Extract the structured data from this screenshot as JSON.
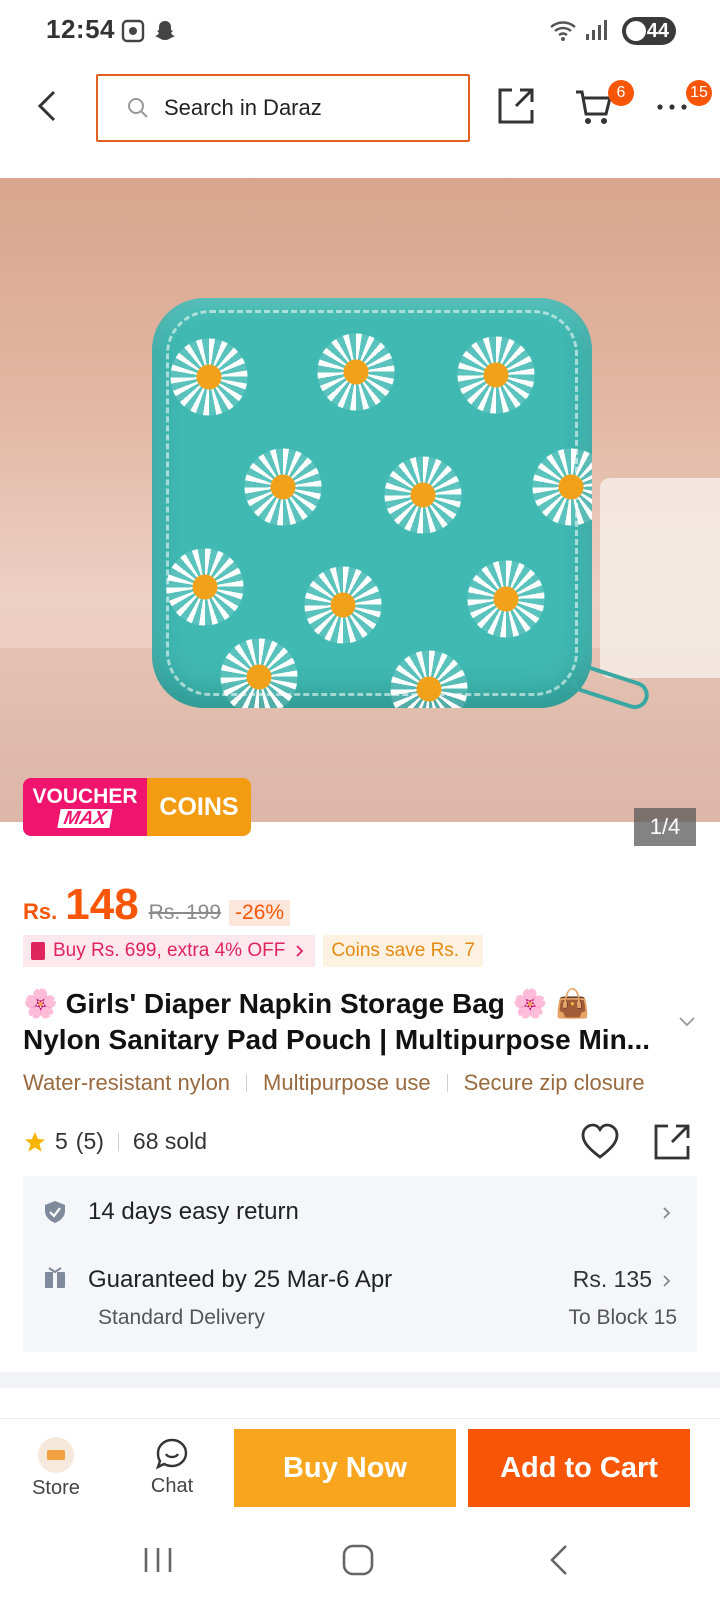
{
  "status_bar": {
    "time": "12:54",
    "battery": "44"
  },
  "header": {
    "search_placeholder": "Search in Daraz",
    "cart_badge": "6",
    "more_badge": "15"
  },
  "gallery": {
    "counter": "1/4",
    "voucher_line1": "VOUCHER",
    "voucher_line2": "MAX",
    "coins_label": "COINS"
  },
  "price": {
    "currency": "Rs.",
    "current": "148",
    "original": "Rs. 199",
    "discount": "-26%"
  },
  "promos": {
    "bundle": "Buy Rs. 699, extra 4% OFF",
    "coins_save": "Coins save Rs. 7"
  },
  "product": {
    "title_line1": "🌸 Girls' Diaper Napkin Storage Bag 🌸 👜",
    "title_line2": "Nylon Sanitary Pad Pouch | Multipurpose Min...",
    "features": [
      "Water-resistant nylon",
      "Multipurpose use",
      "Secure zip closure"
    ],
    "rating": "5",
    "rating_count": "(5)",
    "sold": "68 sold"
  },
  "services": {
    "return_text": "14 days easy return",
    "delivery_text": "Guaranteed by 25 Mar-6 Apr",
    "delivery_type": "Standard Delivery",
    "delivery_price": "Rs. 135",
    "delivery_destination": "To Block 15"
  },
  "bottom_bar": {
    "store_label": "Store",
    "chat_label": "Chat",
    "buy_now_label": "Buy Now",
    "add_to_cart_label": "Add to Cart"
  },
  "colors": {
    "brand_orange": "#f85606",
    "buy_now": "#f9a51d",
    "voucher_pink": "#f0146e",
    "product_teal": "#3fb9b2"
  },
  "icons": [
    "back-arrow-icon",
    "search-icon",
    "share-icon",
    "cart-icon",
    "more-icon",
    "star-icon",
    "heart-icon",
    "shield-check-icon",
    "delivery-box-icon",
    "chevron-right-icon",
    "chat-icon",
    "recents-icon",
    "home-icon",
    "back-nav-icon"
  ]
}
